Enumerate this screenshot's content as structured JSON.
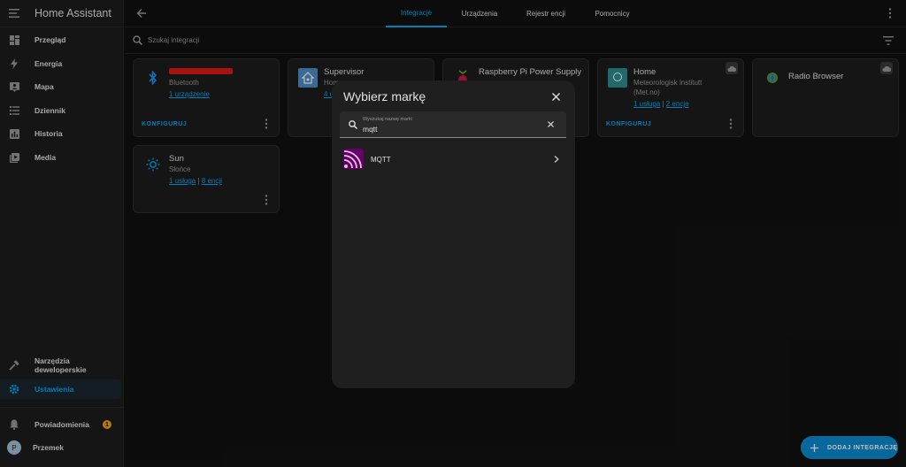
{
  "sidebar": {
    "title": "Home Assistant",
    "items": [
      {
        "label": "Przegląd",
        "icon": "dashboard-icon"
      },
      {
        "label": "Energia",
        "icon": "lightning-icon"
      },
      {
        "label": "Mapa",
        "icon": "map-icon"
      },
      {
        "label": "Dziennik",
        "icon": "list-icon"
      },
      {
        "label": "Historia",
        "icon": "chart-icon"
      },
      {
        "label": "Media",
        "icon": "media-icon"
      }
    ],
    "dev_tools": "Narzędzia deweloperskie",
    "settings": "Ustawienia",
    "notifications": "Powiadomienia",
    "notifications_count": "1",
    "user": "Przemek",
    "user_initial": "P"
  },
  "topbar": {
    "tabs": [
      "Integracje",
      "Urządzenia",
      "Rejestr encji",
      "Pomocnicy"
    ],
    "active_tab": "Integracje"
  },
  "search": {
    "placeholder": "Szukaj integracji"
  },
  "cards": [
    {
      "name": "",
      "sub": "Bluetooth",
      "link1": "1 urządzenie",
      "configure": "KONFIGURUJ",
      "redacted": true
    },
    {
      "name": "Supervisor",
      "sub": "Home",
      "link1": "4 u"
    },
    {
      "name": "Raspberry Pi Power Supply"
    },
    {
      "name": "Home",
      "sub_lines": [
        "Meteorologisk institutt",
        "(Met.no)"
      ],
      "link1": "1 usługa",
      "link2": "2 encje",
      "configure": "KONFIGURUJ"
    },
    {
      "name": "Radio Browser"
    },
    {
      "name": "Sun",
      "sub": "Słońce",
      "link1": "1 usługa",
      "link2": "8 encji"
    }
  ],
  "modal": {
    "title": "Wybierz markę",
    "search_label": "Wyszukaj nazwę marki",
    "search_value": "mqtt",
    "results": [
      {
        "label": "MQTT",
        "icon": "mqtt-icon"
      }
    ]
  },
  "fab": {
    "label": "DODAJ INTEGRACJĘ"
  },
  "colors": {
    "accent": "#03a9f4",
    "background": "#111111",
    "card": "#1c1c1c",
    "modal": "#1f1f1f",
    "mqtt": "#660066",
    "badge": "#f0a020",
    "redaction": "#e01818"
  }
}
